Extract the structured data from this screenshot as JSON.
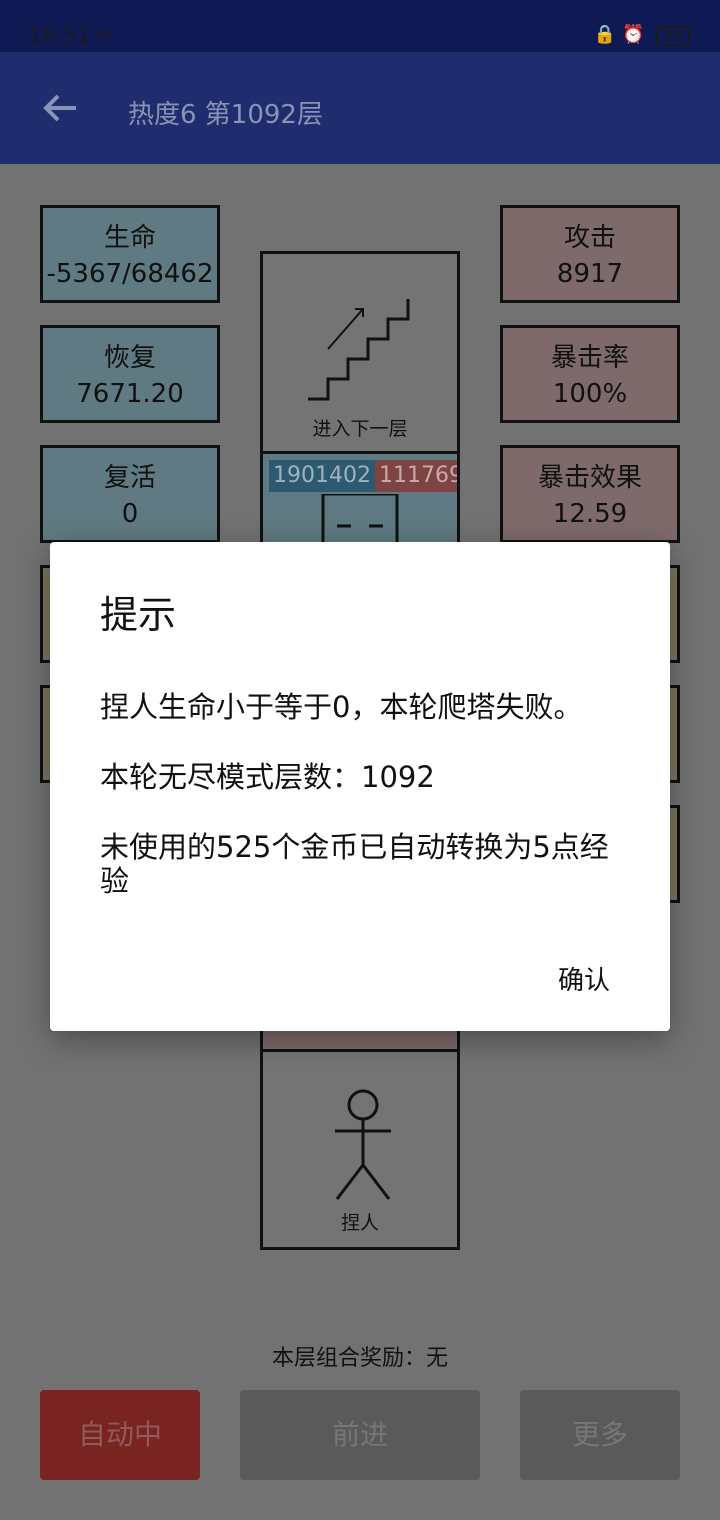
{
  "status": {
    "time": "16:51",
    "signal": "4G",
    "battery": "99"
  },
  "appbar": {
    "title": "热度6 第1092层",
    "back_icon": "arrow-left-icon"
  },
  "stats_left": [
    {
      "label": "生命",
      "value": "-5367/68462"
    },
    {
      "label": "恢复",
      "value": "7671.20"
    },
    {
      "label": "复活",
      "value": "0"
    }
  ],
  "stats_right": [
    {
      "label": "攻击",
      "value": "8917"
    },
    {
      "label": "暴击率",
      "value": "100%"
    },
    {
      "label": "暴击效果",
      "value": "12.59"
    }
  ],
  "tower": {
    "stairs_label": "进入下一层",
    "enemy_hp": "1901402",
    "enemy_atk": "111769",
    "player_label": "捏人"
  },
  "reward_text": "本层组合奖励：无",
  "buttons": {
    "auto": "自动中",
    "forward": "前进",
    "more": "更多"
  },
  "dialog": {
    "title": "提示",
    "line1": "捏人生命小于等于0，本轮爬塔失败。",
    "line2": "本轮无尽模式层数：1092",
    "line3": "未使用的525个金币已自动转换为5点经验",
    "confirm": "确认"
  },
  "colors": {
    "appbar": "#1f2c6e",
    "accent_red": "#7a2422",
    "dialog_bg": "#ffffff"
  }
}
